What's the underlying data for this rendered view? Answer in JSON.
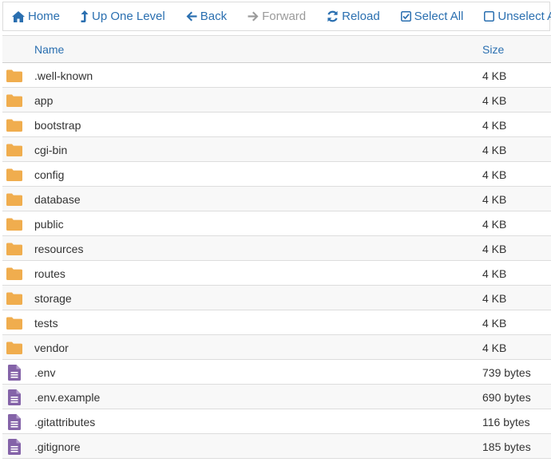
{
  "colors": {
    "link": "#2a6fb0",
    "disabled": "#9a9a9a",
    "folder": "#f0ad4e",
    "file": "#8463a8"
  },
  "toolbar": {
    "home_label": "Home",
    "up_label": "Up One Level",
    "back_label": "Back",
    "forward_label": "Forward",
    "reload_label": "Reload",
    "select_all_label": "Select All",
    "unselect_all_label": "Unselect All"
  },
  "table": {
    "columns": {
      "name": "Name",
      "size": "Size"
    },
    "rows": [
      {
        "icon": "folder-icon",
        "name": ".well-known",
        "size": "4 KB"
      },
      {
        "icon": "folder-icon",
        "name": "app",
        "size": "4 KB"
      },
      {
        "icon": "folder-icon",
        "name": "bootstrap",
        "size": "4 KB"
      },
      {
        "icon": "folder-icon",
        "name": "cgi-bin",
        "size": "4 KB"
      },
      {
        "icon": "folder-icon",
        "name": "config",
        "size": "4 KB"
      },
      {
        "icon": "folder-icon",
        "name": "database",
        "size": "4 KB"
      },
      {
        "icon": "folder-icon",
        "name": "public",
        "size": "4 KB"
      },
      {
        "icon": "folder-icon",
        "name": "resources",
        "size": "4 KB"
      },
      {
        "icon": "folder-icon",
        "name": "routes",
        "size": "4 KB"
      },
      {
        "icon": "folder-icon",
        "name": "storage",
        "size": "4 KB"
      },
      {
        "icon": "folder-icon",
        "name": "tests",
        "size": "4 KB"
      },
      {
        "icon": "folder-icon",
        "name": "vendor",
        "size": "4 KB"
      },
      {
        "icon": "file-text-icon",
        "name": ".env",
        "size": "739 bytes"
      },
      {
        "icon": "file-text-icon",
        "name": ".env.example",
        "size": "690 bytes"
      },
      {
        "icon": "file-text-icon",
        "name": ".gitattributes",
        "size": "116 bytes"
      },
      {
        "icon": "file-text-icon",
        "name": ".gitignore",
        "size": "185 bytes"
      }
    ]
  }
}
